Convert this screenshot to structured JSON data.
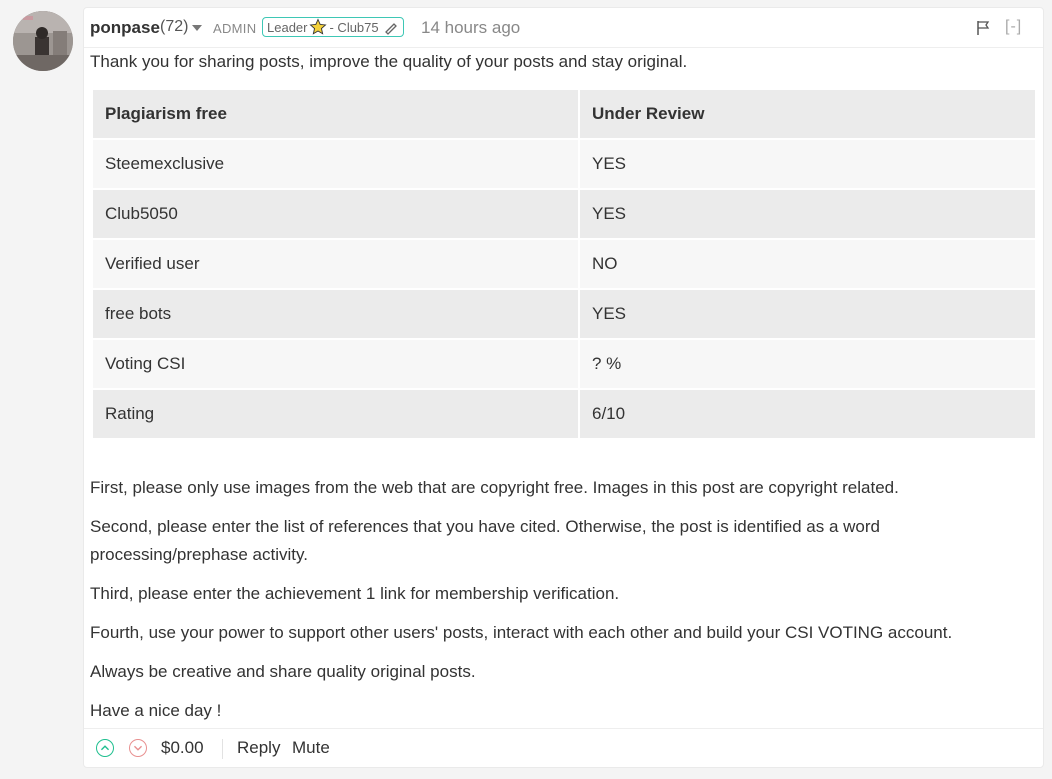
{
  "comment": {
    "author": "ponpase",
    "reputation": "(72)",
    "role": "ADMIN",
    "badge_text_left": "Leader",
    "badge_text_right": "- Club75",
    "time": "14 hours ago",
    "collapse_label": "[-]",
    "intro": "Thank you for sharing posts, improve the quality of your posts and stay original.",
    "table": {
      "headers": [
        "Plagiarism free",
        "Under Review"
      ],
      "rows": [
        [
          "Steemexclusive",
          "YES"
        ],
        [
          "Club5050",
          "YES"
        ],
        [
          "Verified user",
          "NO"
        ],
        [
          "free bots",
          "YES"
        ],
        [
          "Voting CSI",
          "? %"
        ],
        [
          "Rating",
          "6/10"
        ]
      ]
    },
    "paragraphs": [
      "First, please only use images from the web that are copyright free. Images in this post are copyright related.",
      "Second, please enter the list of references that you have cited. Otherwise, the post is identified as a word processing/prephase activity.",
      "Third, please enter the achievement 1 link for membership verification.",
      "Fourth, use your power to support other users' posts, interact with each other and build your CSI VOTING account.",
      "Always be creative and share quality original posts.",
      "Have a nice day !"
    ],
    "footer": {
      "payout": "$0.00",
      "reply_label": "Reply",
      "mute_label": "Mute"
    }
  },
  "icons": {
    "upvote": "chevron-up-circle-icon",
    "downvote": "chevron-down-circle-icon",
    "flag": "flag-icon",
    "star": "star-icon",
    "pen": "pen-icon"
  },
  "colors": {
    "badge_border": "#3ec7b5",
    "upvote": "#1fbf8f",
    "downvote": "#e89090"
  }
}
